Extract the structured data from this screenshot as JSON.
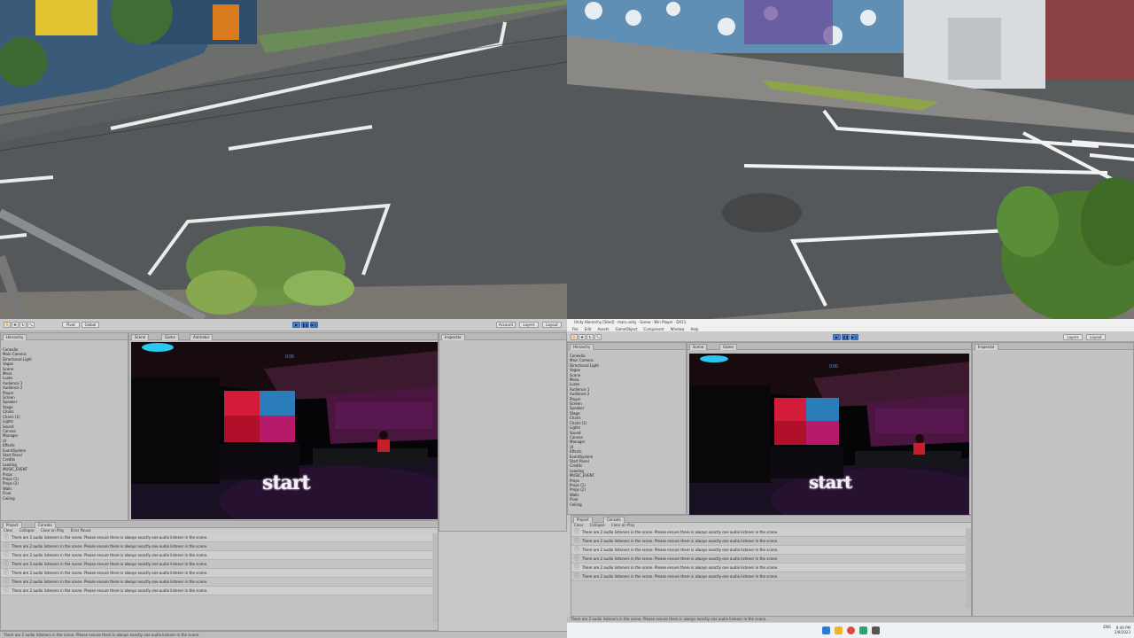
{
  "window": {
    "title": "Unity Hierarchy [Shell] · main.unity · Scene · Win Player · DX11"
  },
  "menu": [
    "File",
    "Edit",
    "Assets",
    "GameObject",
    "Component",
    "Window",
    "Help"
  ],
  "hierarchy": {
    "tab": "Hierarchy",
    "items": [
      "Conexão",
      "  Main Camera",
      "  Directional Light",
      "  Vagas",
      "  Scene",
      "  Mesa",
      "  Luzes",
      "  Audience 1",
      "  Audience 2",
      "  Player",
      "  Screen",
      "  Speaker",
      "  Stage",
      "  Chairs",
      "  Chairs (1)",
      "  Lights",
      "  Sound",
      "  Canvas",
      "  Manager",
      "  UI",
      "  Effects",
      "  EventSystem",
      "  Start Panel",
      "  Credits",
      "  Loading",
      "  MUSIC_EVENT",
      "  Props",
      "  Props (1)",
      "  Props (2)",
      "  Walls",
      "  Floor",
      "  Ceiling"
    ]
  },
  "tabs": {
    "scene": "Scene",
    "game": "Game",
    "animator": "Animator",
    "inspector": "Inspector",
    "project": "Project",
    "console": "Console"
  },
  "game": {
    "start_label": "start",
    "display_label": "0:00"
  },
  "console": {
    "toolbar": [
      "Clear",
      "Collapse",
      "Clear on Play",
      "Error Pause"
    ],
    "message": "There are 2 audio listeners in the scene. Please ensure there is always exactly one audio listener in the scene.",
    "count_left": 7,
    "count_right": 6
  },
  "status": {
    "message": "There are 2 audio listeners in the scene. Please ensure there is always exactly one audio listener in the scene."
  },
  "taskbar": {
    "clock_time": "8:46 PM",
    "clock_date": "2/9/2023",
    "lang": "ENG"
  },
  "colors": {
    "play_accent": "#4a7fd1",
    "taskbar_bg": "#eef1f6"
  }
}
